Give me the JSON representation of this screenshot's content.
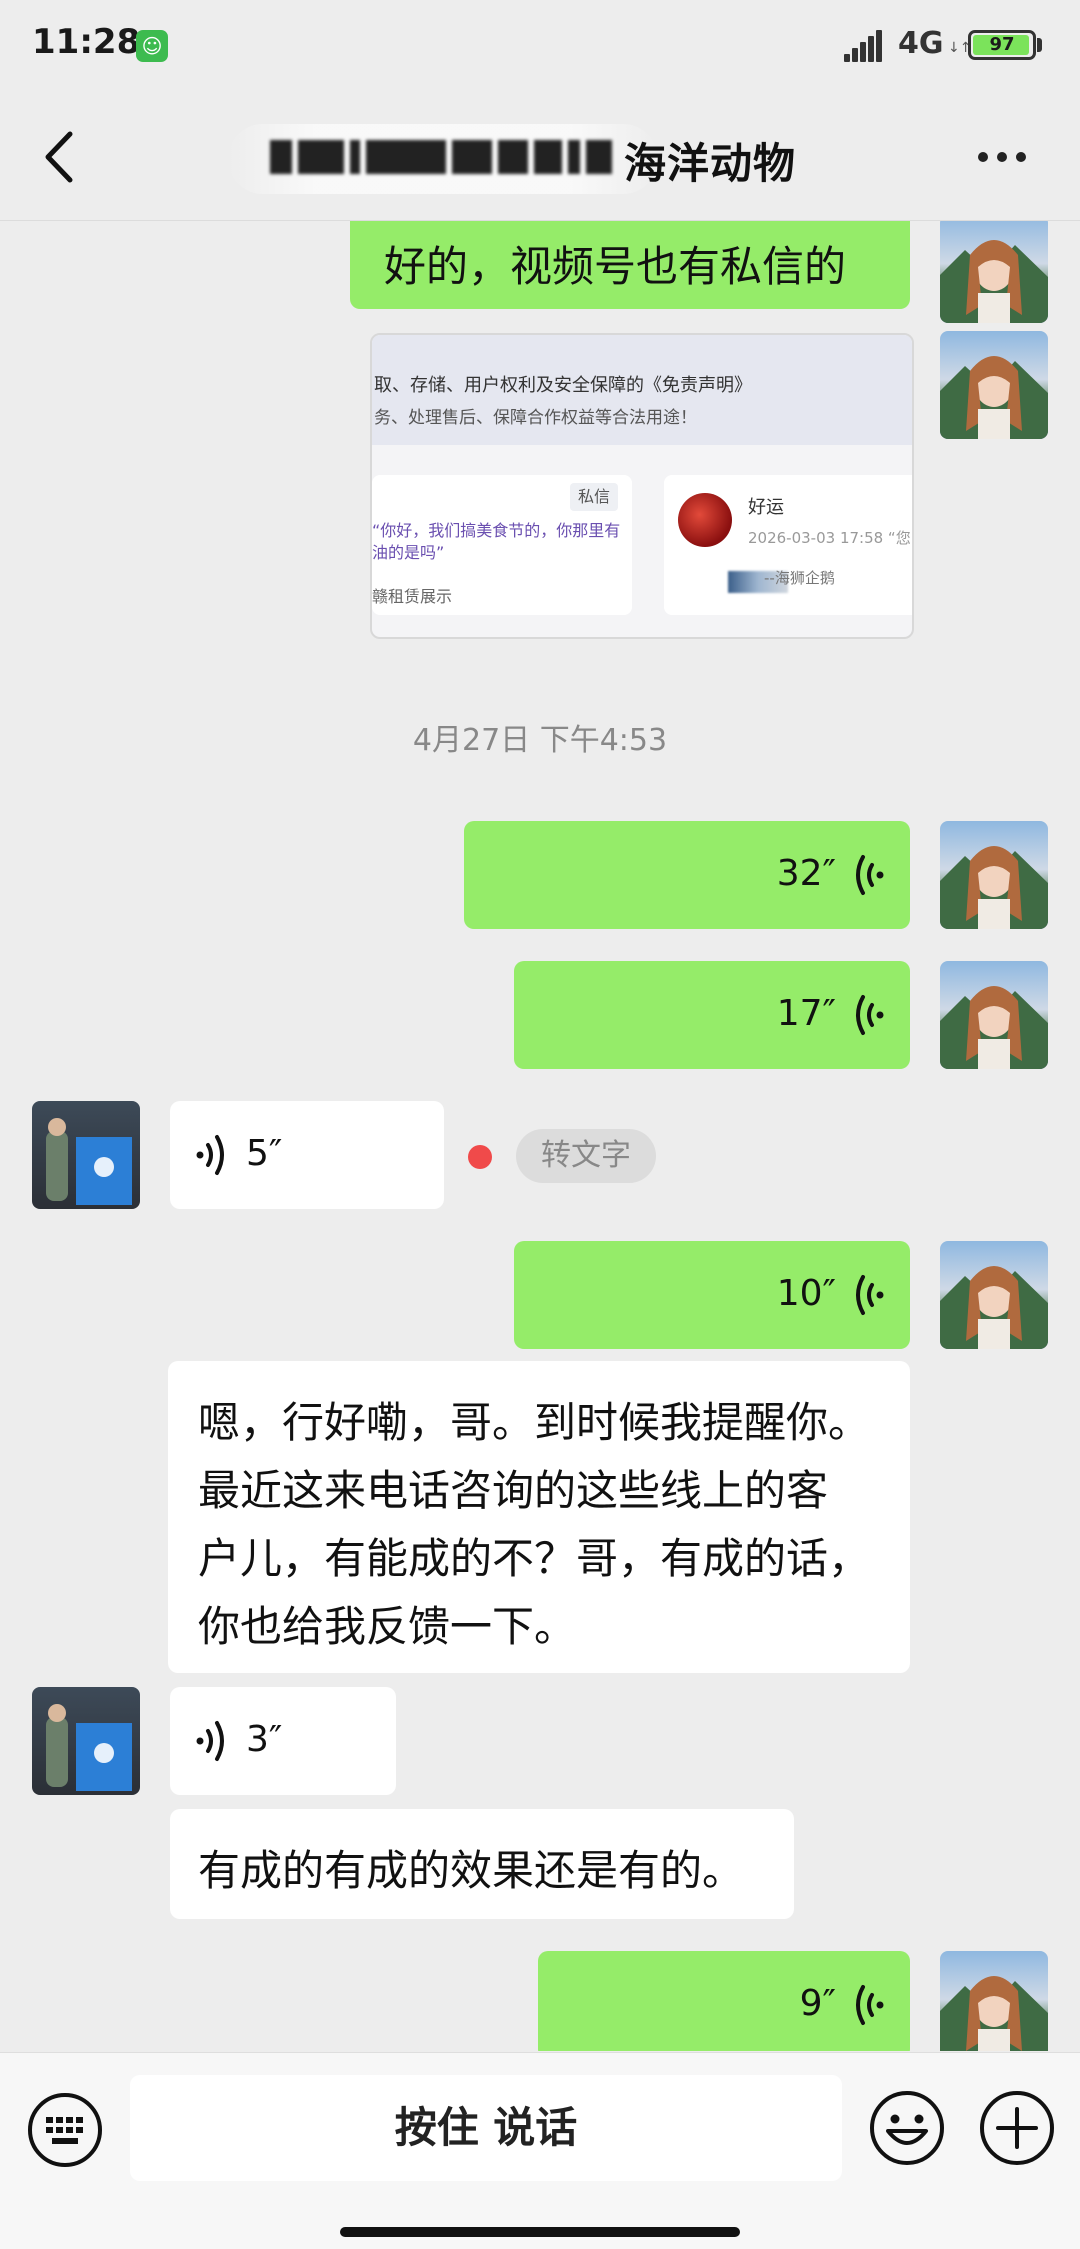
{
  "status_bar": {
    "time": "11:28",
    "network": "4G",
    "battery": "97",
    "battery_level": 0.97
  },
  "title_bar": {
    "title_visible": "海洋动物"
  },
  "messages": {
    "m1_text": "好的，视频号也有私信的",
    "image_card": {
      "line1": "取、存储、用户权利及安全保障的《免责声明》",
      "line2": "务、处理售后、保障合作权益等合法用途！",
      "left_tag": "私信",
      "left_a": "“你好，我们搞美食节的，你那里有",
      "left_b": "油的是吗”",
      "left_c": "赣租赁展示",
      "right_name": "好运",
      "right_date": "2026-03-03 17:58 “您",
      "right_sub": "--海狮企鹅"
    },
    "timestamp": "4月27日 下午4:53",
    "v1_duration": "32″",
    "v2_duration": "17″",
    "v3_duration": "5″",
    "convert_to_text": "转文字",
    "v4_duration": "10″",
    "t_lines": [
      "嗯，行好嘞，哥。到时候我提醒你。",
      "最近这来电话咨询的这些线上的客",
      "户儿，有能成的不？哥，有成的话，",
      "你也给我反馈一下。"
    ],
    "v5_duration": "3″",
    "t2_text": "有成的有成的效果还是有的。",
    "v6_duration": "9″"
  },
  "input_bar": {
    "hold_to_talk": "按住 说话"
  },
  "icons": {
    "back": "chevron-left-icon",
    "more": "more-icon",
    "keyboard": "keyboard-icon",
    "emoji": "emoji-icon",
    "plus": "plus-icon",
    "voice": "voice-wave-icon"
  },
  "colors": {
    "background": "#ededed",
    "self_bubble": "#95ec69",
    "other_bubble": "#ffffff",
    "battery": "#7be35b"
  }
}
